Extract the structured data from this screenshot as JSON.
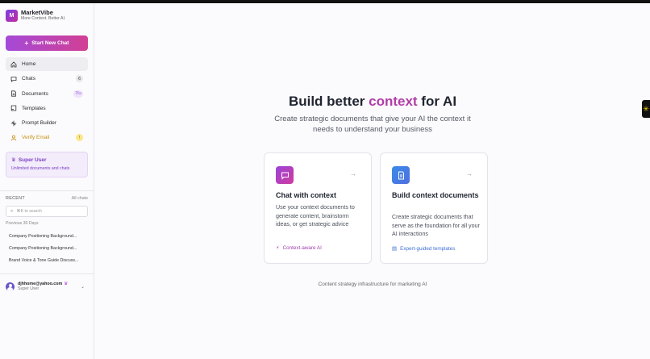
{
  "app": {
    "name": "MarketVibe",
    "tagline": "More Context. Better AI.",
    "logo_letter": "M"
  },
  "sidebar": {
    "new_chat_label": "Start New Chat",
    "items": [
      {
        "label": "Home",
        "icon": "home-icon",
        "active": true
      },
      {
        "label": "Chats",
        "icon": "chat-icon",
        "badge": "6"
      },
      {
        "label": "Documents",
        "icon": "document-icon",
        "badge": "7/∞"
      },
      {
        "label": "Templates",
        "icon": "template-icon"
      },
      {
        "label": "Prompt Builder",
        "icon": "prompt-builder-icon"
      },
      {
        "label": "Verify Email",
        "icon": "user-icon",
        "badge": "!"
      }
    ],
    "plan": {
      "title": "Super User",
      "subtitle": "Unlimited documents and chats"
    },
    "recent": {
      "label": "RECENT",
      "all_chats": "All chats",
      "search_placeholder": "⌘K to search",
      "period": "Previous 30 Days",
      "items": [
        "Company Positioning Background...",
        "Company Positioning Background...",
        "Brand Voice & Tone Guide Discuss..."
      ]
    },
    "user": {
      "email": "djhhome@yahoo.com",
      "role": "Super User"
    }
  },
  "main": {
    "title_prefix": "Build better ",
    "title_accent": "context",
    "title_suffix": " for AI",
    "subtitle": "Create strategic documents that give your AI the context it needs to understand your business",
    "cards": [
      {
        "title": "Chat with context",
        "description": "Use your context documents to generate content, brainstorm ideas, or get strategic advice",
        "footer": "Context-aware AI"
      },
      {
        "title": "Build context documents",
        "description": "Create strategic documents that serve as the foundation for all your AI interactions",
        "footer": "Expert-guided templates"
      }
    ],
    "footer_note": "Content strategy infrastructure for marketing AI"
  },
  "colors": {
    "accent": "#b03ea6",
    "button_gradient_start": "#a44ad8",
    "button_gradient_end": "#d23f93",
    "card2_icon": "#3a8be8"
  }
}
